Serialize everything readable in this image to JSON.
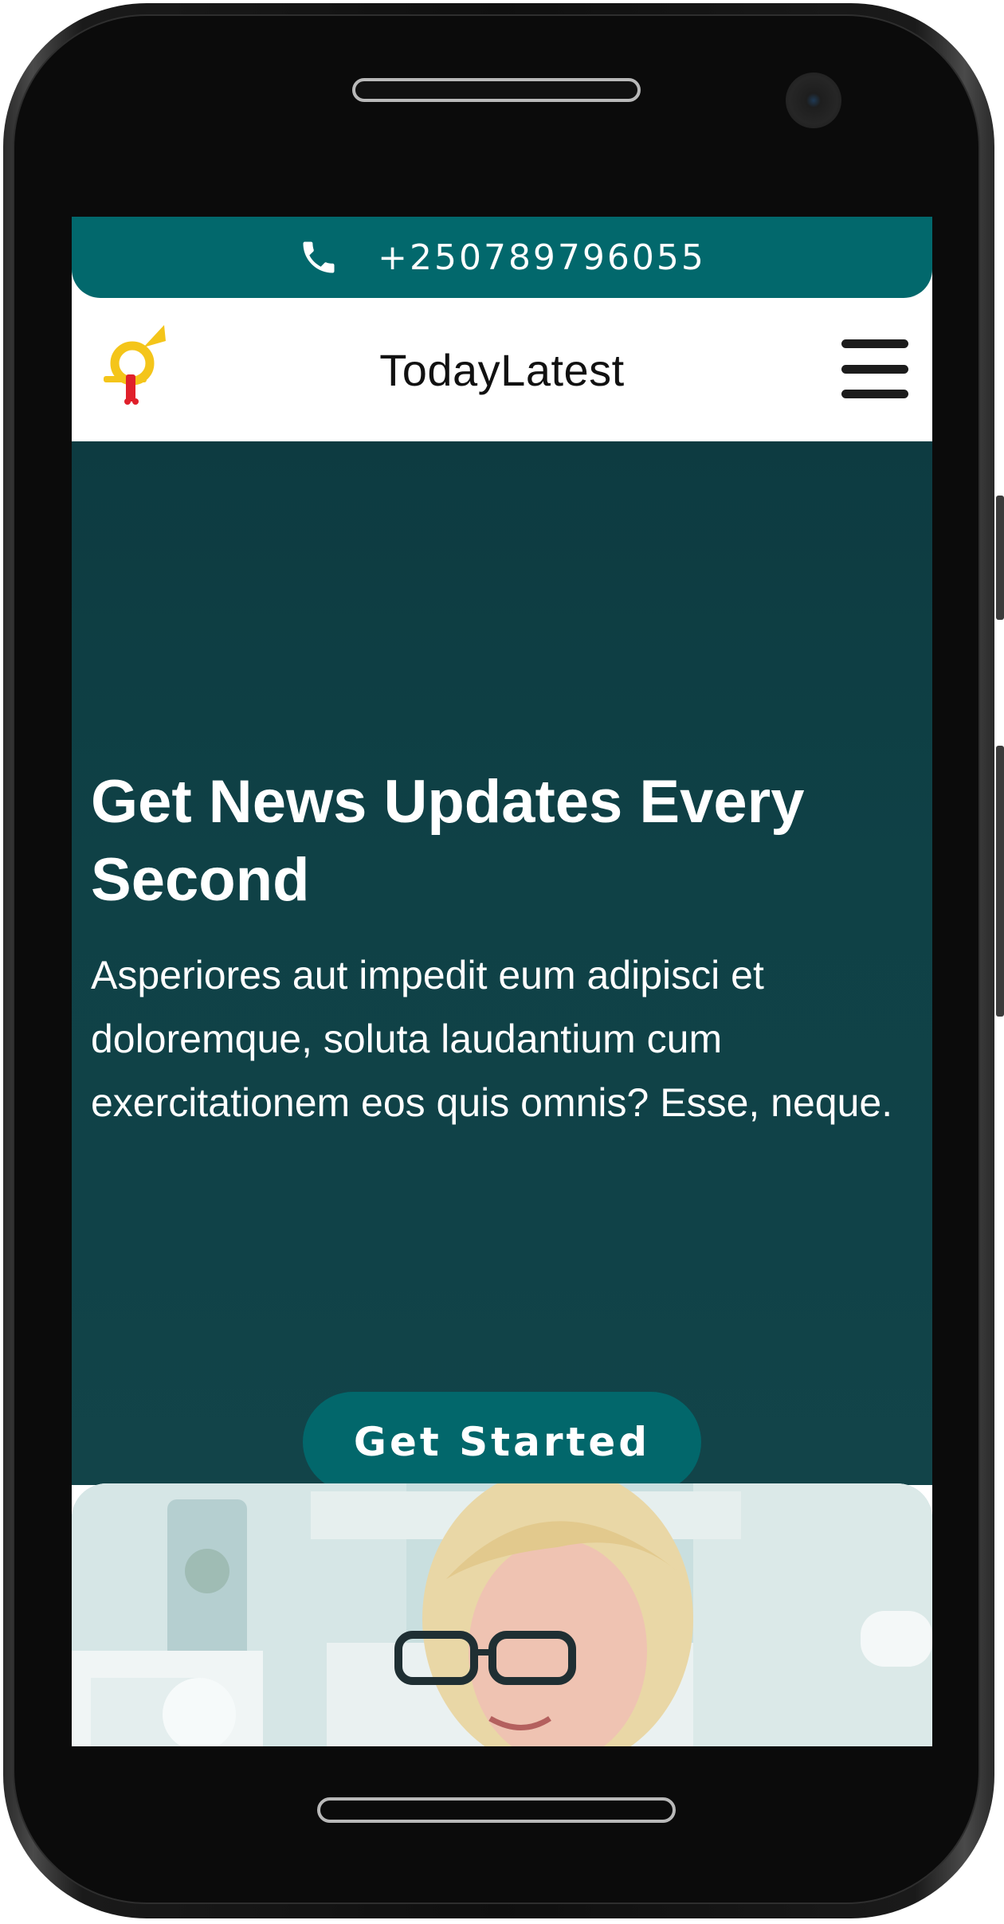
{
  "topbar": {
    "phone_icon": "phone-icon",
    "phone_number": "+250789796055",
    "background": "#02686c"
  },
  "navbar": {
    "logo_icon": "post-horn-logo",
    "brand": "TodayLatest",
    "menu_icon": "hamburger-menu-icon"
  },
  "hero": {
    "title": "Get News Updates Every Second",
    "text": "Asperiores aut impedit eum adipisci et doloremque, soluta laudantium cum exercitationem eos quis omnis? Esse, neque.",
    "cta_label": "Get Started",
    "background": "#0f4146",
    "cta_color": "#02676b"
  },
  "photo": {
    "subject": "woman-with-glasses-photo"
  }
}
